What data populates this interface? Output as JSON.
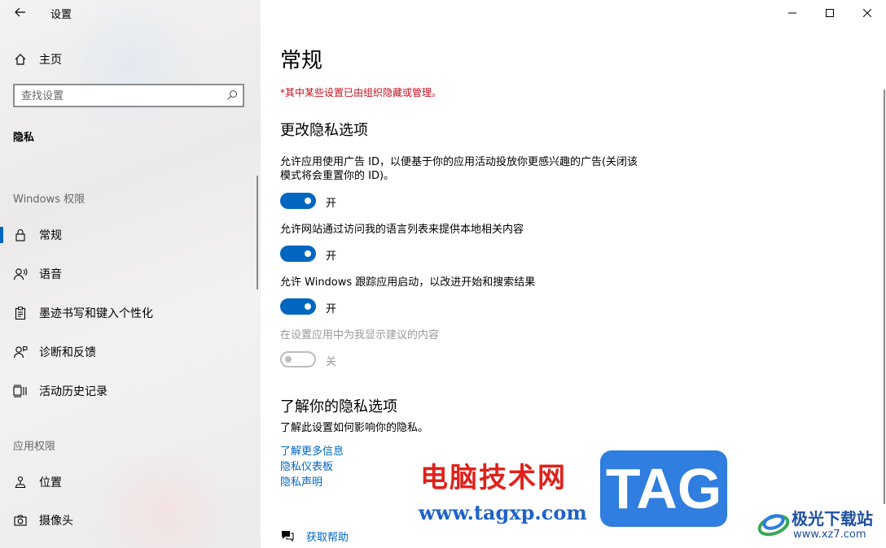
{
  "window": {
    "title": "设置"
  },
  "sidebar": {
    "home_label": "主页",
    "search_placeholder": "查找设置",
    "category_label": "隐私",
    "windows_section": "Windows 权限",
    "windows_items": [
      {
        "label": "常规",
        "icon": "lock-icon",
        "active": true
      },
      {
        "label": "语音",
        "icon": "speech-icon",
        "active": false
      },
      {
        "label": "墨迹书写和键入个性化",
        "icon": "clipboard-icon",
        "active": false
      },
      {
        "label": "诊断和反馈",
        "icon": "person-feedback-icon",
        "active": false
      },
      {
        "label": "活动历史记录",
        "icon": "timeline-icon",
        "active": false
      }
    ],
    "app_section": "应用权限",
    "app_items": [
      {
        "label": "位置",
        "icon": "location-icon"
      },
      {
        "label": "摄像头",
        "icon": "camera-icon"
      }
    ]
  },
  "main": {
    "title": "常规",
    "managed_warning": "*其中某些设置已由组织隐藏或管理。",
    "section_title": "更改隐私选项",
    "options": [
      {
        "desc": "允许应用使用广告 ID，以便基于你的应用活动投放你更感兴趣的广告(关闭该模式将会重置你的 ID)。",
        "state": "开",
        "on": true,
        "disabled": false
      },
      {
        "desc": "允许网站通过访问我的语言列表来提供本地相关内容",
        "state": "开",
        "on": true,
        "disabled": false
      },
      {
        "desc": "允许 Windows 跟踪应用启动，以改进开始和搜索结果",
        "state": "开",
        "on": true,
        "disabled": false
      },
      {
        "desc": "在设置应用中为我显示建议的内容",
        "state": "关",
        "on": false,
        "disabled": true
      }
    ],
    "learn_title": "了解你的隐私选项",
    "learn_desc": "了解此设置如何影响你的隐私。",
    "links": [
      "了解更多信息",
      "隐私仪表板",
      "隐私声明"
    ],
    "help_label": "获取帮助"
  },
  "watermark": {
    "cn_text": "电脑技术网",
    "url": "www.tagxp.com",
    "tag": "TAG",
    "site_cn": "极光下载站",
    "site_url": "www.xz7.com"
  },
  "colors": {
    "accent": "#0067c0",
    "warning": "#c50f1f"
  }
}
